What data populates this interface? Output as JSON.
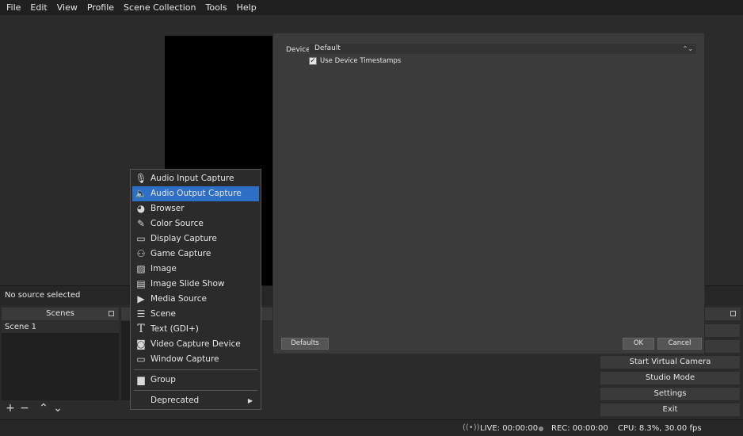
{
  "menubar": {
    "items": [
      "File",
      "Edit",
      "View",
      "Profile",
      "Scene Collection",
      "Tools",
      "Help"
    ]
  },
  "source_bar": {
    "status": "No source selected"
  },
  "docks": {
    "scenes": {
      "title": "Scenes",
      "items": [
        "Scene 1"
      ]
    }
  },
  "controls": {
    "start_virtual_camera": "Start Virtual Camera",
    "studio_mode": "Studio Mode",
    "settings": "Settings",
    "exit": "Exit"
  },
  "statusbar": {
    "live": "LIVE: 00:00:00",
    "rec": "REC: 00:00:00",
    "cpu": "CPU: 8.3%, 30.00 fps"
  },
  "dialog": {
    "device_label": "Device",
    "device_value": "Default",
    "use_timestamps_label": "Use Device Timestamps",
    "use_timestamps_checked": true,
    "defaults_button": "Defaults",
    "ok_button": "OK",
    "cancel_button": "Cancel"
  },
  "context_menu": {
    "items": [
      {
        "label": "Audio Input Capture",
        "icon": "microphone-icon"
      },
      {
        "label": "Audio Output Capture",
        "icon": "speaker-icon",
        "selected": true
      },
      {
        "label": "Browser",
        "icon": "globe-icon"
      },
      {
        "label": "Color Source",
        "icon": "brush-icon"
      },
      {
        "label": "Display Capture",
        "icon": "monitor-icon"
      },
      {
        "label": "Game Capture",
        "icon": "gamepad-icon"
      },
      {
        "label": "Image",
        "icon": "image-icon"
      },
      {
        "label": "Image Slide Show",
        "icon": "slideshow-icon"
      },
      {
        "label": "Media Source",
        "icon": "play-icon"
      },
      {
        "label": "Scene",
        "icon": "list-icon"
      },
      {
        "label": "Text (GDI+)",
        "icon": "text-icon"
      },
      {
        "label": "Video Capture Device",
        "icon": "camera-icon"
      },
      {
        "label": "Window Capture",
        "icon": "window-icon"
      }
    ],
    "group": {
      "label": "Group",
      "icon": "folder-icon"
    },
    "deprecated": {
      "label": "Deprecated"
    }
  }
}
